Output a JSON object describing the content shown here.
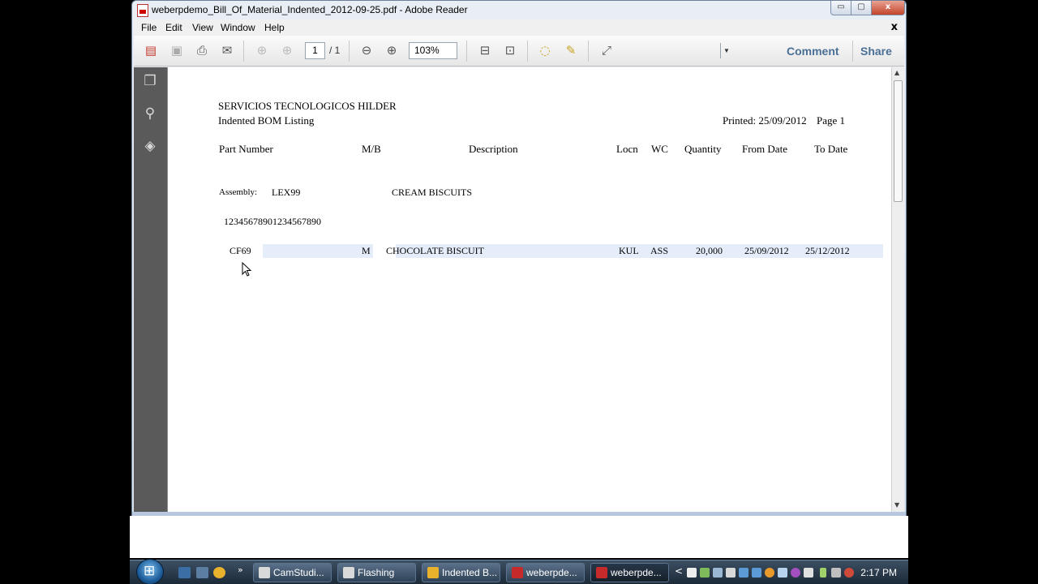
{
  "window": {
    "title": "weberpdemo_Bill_Of_Material_Indented_2012-09-25.pdf - Adobe Reader",
    "controls": {
      "minimize": "▭",
      "maximize": "▢",
      "close": "x"
    }
  },
  "menu": {
    "items": [
      "File",
      "Edit",
      "View",
      "Window",
      "Help"
    ],
    "close_doc": "x"
  },
  "toolbar": {
    "page_current": "1",
    "page_total": "/ 1",
    "zoom": "103%",
    "zoom_dropdown": "▼",
    "comment": "Comment",
    "share": "Share"
  },
  "document": {
    "company": "SERVICIOS TECNOLOGICOS HILDER",
    "report": "Indented BOM Listing",
    "printed": "Printed: 25/09/2012",
    "page": "Page 1",
    "columns": [
      "Part Number",
      "M/B",
      "Description",
      "Locn",
      "WC",
      "Quantity",
      "From Date",
      "To Date"
    ],
    "assembly_label": "Assembly:",
    "assembly_code": "LEX99",
    "assembly_desc": "CREAM BISCUITS",
    "digits_line": "12345678901234567890",
    "row": {
      "part": "CF69",
      "mb": "M",
      "description": "CHOCOLATE BISCUIT",
      "locn": "KUL",
      "wc": "ASS",
      "quantity": "20,000",
      "from_date": "25/09/2012",
      "to_date": "25/12/2012"
    }
  },
  "taskbar": {
    "buttons": [
      {
        "label": "CamStudi...",
        "icon_color": "#d9d9d9"
      },
      {
        "label": "Flashing",
        "icon_color": "#d9d9d9"
      },
      {
        "label": "Indented B...",
        "icon_color": "#e8b22c"
      },
      {
        "label": "weberpde...",
        "icon_color": "#c62a2a"
      },
      {
        "label": "weberpde...",
        "icon_color": "#c62a2a"
      }
    ],
    "clock": "2:17 PM",
    "more": "»",
    "tray_toggle": "<"
  }
}
